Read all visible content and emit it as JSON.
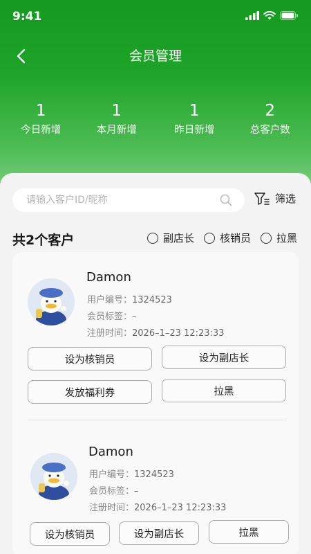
{
  "status_bar": {
    "time": "9:41"
  },
  "header": {
    "title": "会员管理"
  },
  "stats": [
    {
      "value": "1",
      "label": "今日新增"
    },
    {
      "value": "1",
      "label": "本月新增"
    },
    {
      "value": "1",
      "label": "昨日新增"
    },
    {
      "value": "2",
      "label": "总客户数"
    }
  ],
  "search": {
    "placeholder": "请输入客户ID/昵称",
    "value": "",
    "filter_label": "筛选"
  },
  "list_header": {
    "count_title": "共2个客户",
    "filters": [
      "副店长",
      "核销员",
      "拉黑"
    ]
  },
  "customers": [
    {
      "name": "Damon",
      "id_label": "用户编号：",
      "id_value": "1324523",
      "tag_label": "会员标签：",
      "tag_value": "–",
      "reg_label": "注册时间：",
      "reg_value": "2026–1–23 12:23:33",
      "buttons": [
        "设为核销员",
        "设为副店长",
        "发放福利券",
        "拉黑"
      ]
    },
    {
      "name": "Damon",
      "id_label": "用户编号：",
      "id_value": "1324523",
      "tag_label": "会员标签：",
      "tag_value": "–",
      "reg_label": "注册时间：",
      "reg_value": "2026–1–23 12:23:33",
      "buttons": [
        "设为核销员",
        "设为副店长",
        "拉黑"
      ]
    }
  ],
  "colors": {
    "header_green": "#149a1e",
    "panel_bg": "#f3f3f3"
  },
  "icons": [
    "signal-icon",
    "wifi-icon",
    "battery-icon",
    "back-arrow-icon",
    "search-icon",
    "filter-icon",
    "avatar-duck-icon"
  ]
}
